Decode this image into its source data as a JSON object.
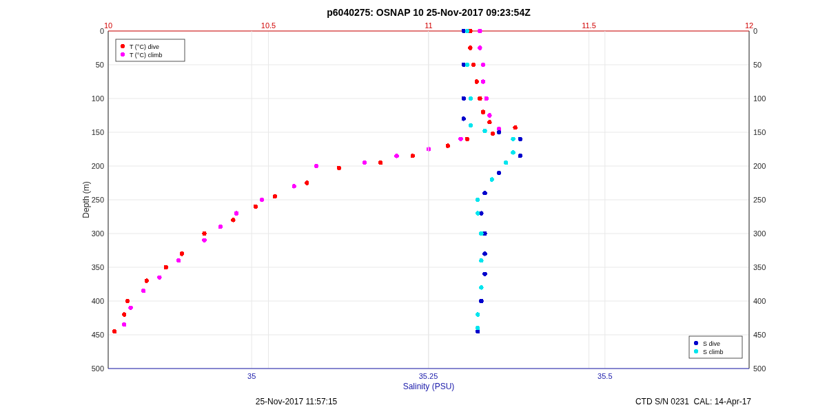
{
  "figure": {
    "temperature": {
      "chart_data": {
        "type": "scatter",
        "grid": true,
        "legend": "upper left",
        "title": "p6040275: OSNAP 10 25-Nov-2017 09:23:54Z",
        "ylabel": "Depth (m)",
        "xlim": [
          10,
          12
        ],
        "ylim": [
          500,
          0
        ],
        "xticks": [
          10,
          10.5,
          11,
          11.5,
          12
        ],
        "yticks": [
          0,
          50,
          100,
          150,
          200,
          250,
          300,
          350,
          400,
          450,
          500
        ],
        "series": [
          {
            "name": "T (°C) dive",
            "color": "#ff0000",
            "x": [
              11.13,
              11.13,
              11.14,
              11.15,
              11.16,
              11.17,
              11.19,
              11.27,
              11.2,
              11.12,
              11.06,
              10.95,
              10.85,
              10.72,
              10.62,
              10.52,
              10.46,
              10.39,
              10.3,
              10.23,
              10.18,
              10.12,
              10.06,
              10.05,
              10.02
            ],
            "values": [
              0,
              25,
              50,
              75,
              100,
              120,
              135,
              143,
              152,
              160,
              170,
              185,
              195,
              203,
              225,
              245,
              260,
              280,
              300,
              330,
              350,
              370,
              400,
              420,
              445
            ]
          },
          {
            "name": "T (°C) climb",
            "color": "#ff00ff",
            "x": [
              11.16,
              11.16,
              11.17,
              11.17,
              11.18,
              11.19,
              11.22,
              11.1,
              11.0,
              10.9,
              10.8,
              10.65,
              10.58,
              10.48,
              10.4,
              10.35,
              10.3,
              10.22,
              10.16,
              10.11,
              10.07,
              10.05
            ],
            "values": [
              0,
              25,
              50,
              75,
              100,
              125,
              145,
              160,
              175,
              185,
              195,
              200,
              230,
              250,
              270,
              290,
              310,
              340,
              365,
              385,
              410,
              435
            ]
          }
        ]
      }
    },
    "salinity": {
      "chart_data": {
        "type": "scatter",
        "grid": true,
        "legend": "lower right",
        "xlabel": "Salinity (PSU)",
        "xlim": [
          34.797,
          35.704
        ],
        "ylim": [
          500,
          0
        ],
        "xticks": [
          35,
          35.25,
          35.5
        ],
        "yticks": [
          0,
          50,
          100,
          150,
          200,
          250,
          300,
          350,
          400,
          450,
          500
        ],
        "series": [
          {
            "name": "S dive",
            "color": "#0000cc",
            "x": [
              35.3,
              35.3,
              35.3,
              35.3,
              35.35,
              35.38,
              35.38,
              35.35,
              35.33,
              35.325,
              35.33,
              35.33,
              35.33,
              35.325,
              35.32
            ],
            "values": [
              0,
              50,
              100,
              130,
              150,
              160,
              185,
              210,
              240,
              270,
              300,
              330,
              360,
              400,
              445
            ]
          },
          {
            "name": "S climb",
            "color": "#00e5ee",
            "x": [
              35.305,
              35.305,
              35.31,
              35.31,
              35.33,
              35.37,
              35.37,
              35.36,
              35.34,
              35.32,
              35.32,
              35.325,
              35.325,
              35.325,
              35.32,
              35.32
            ],
            "values": [
              0,
              50,
              100,
              140,
              148,
              160,
              180,
              195,
              220,
              250,
              270,
              300,
              340,
              380,
              420,
              440
            ]
          }
        ]
      }
    },
    "footer_left": "25-Nov-2017 11:57:15",
    "footer_right": "CTD S/N 0231  CAL: 14-Apr-17"
  }
}
